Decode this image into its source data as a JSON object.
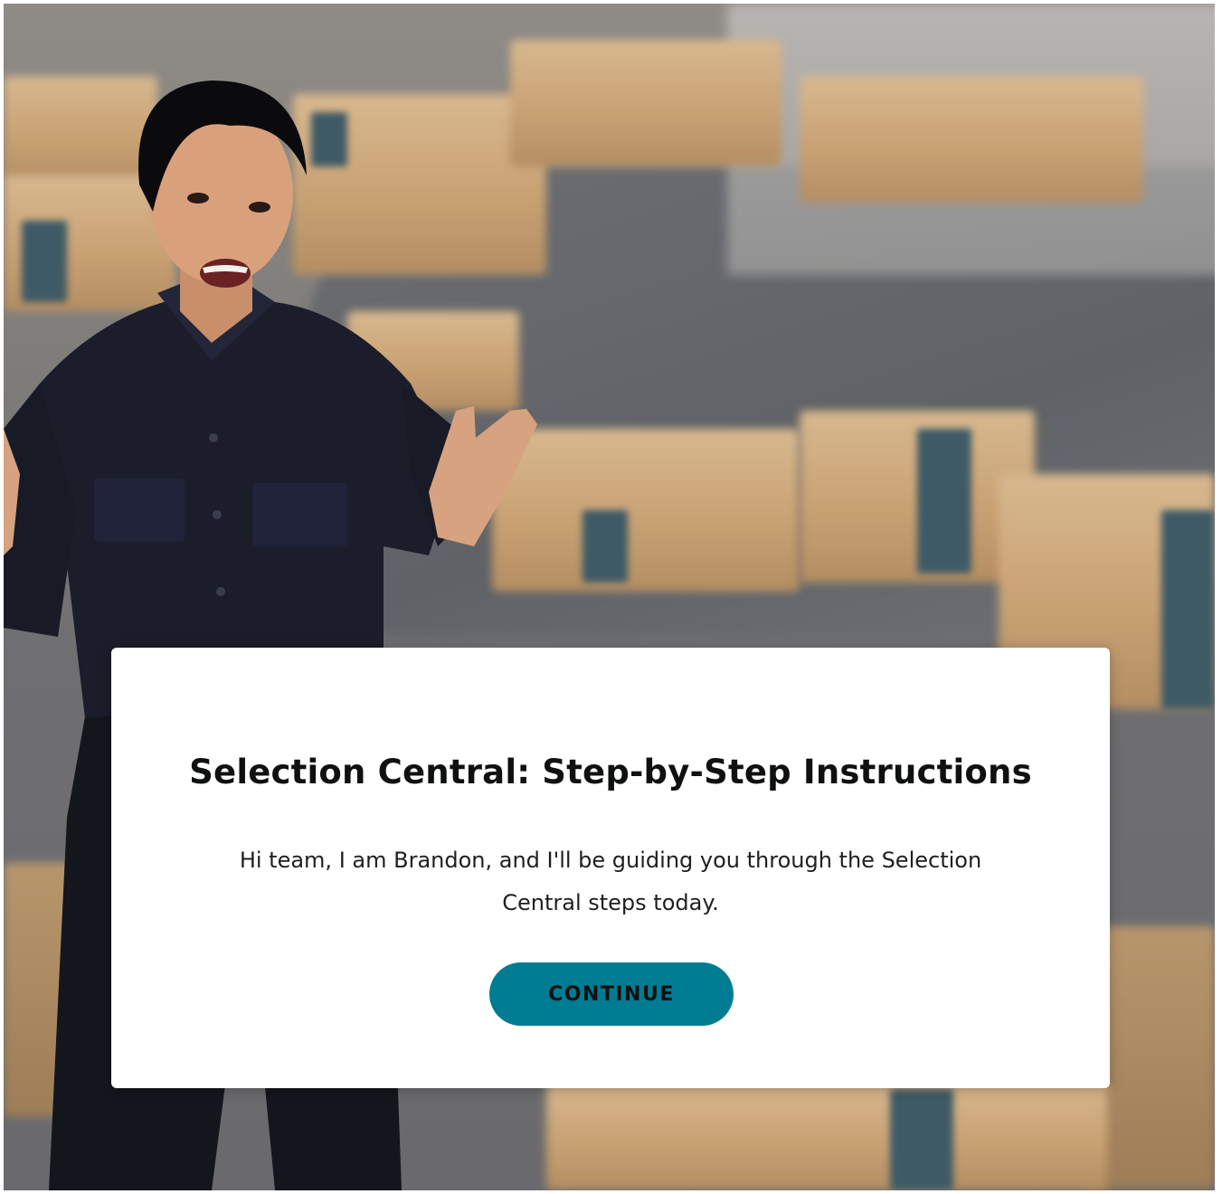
{
  "modal": {
    "title": "Selection Central: Step-by-Step Instructions",
    "body": "Hi team, I am Brandon, and I'll be guiding you through the Selection Central steps today.",
    "continue_label": "CONTINUE"
  },
  "colors": {
    "button_background": "#007c92",
    "button_text": "#0f1111",
    "title_text": "#0f1111",
    "card_background": "#ffffff"
  }
}
